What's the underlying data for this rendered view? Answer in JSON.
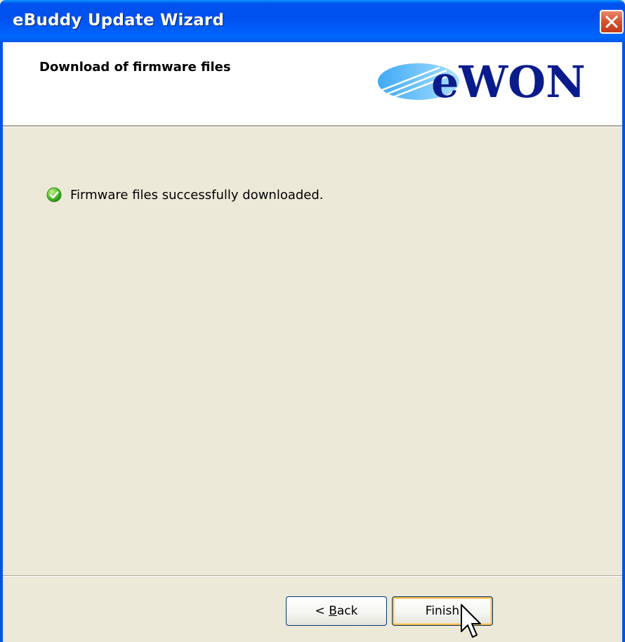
{
  "window": {
    "title": "eBuddy Update Wizard",
    "title_bar_color": "#0054E3",
    "body_color": "#ECE9D8"
  },
  "header": {
    "title": "Download of firmware files",
    "logo_text": "eWON",
    "logo_color": "#0A1C8C"
  },
  "status": {
    "icon": "success-check-icon",
    "message": "Firmware files successfully downloaded."
  },
  "buttons": {
    "back_label_prefix": "< ",
    "back_label_accel": "B",
    "back_label_rest": "ack",
    "finish_label": "Finish"
  },
  "icons": {
    "close": "close-icon",
    "cursor": "mouse-pointer-icon"
  }
}
